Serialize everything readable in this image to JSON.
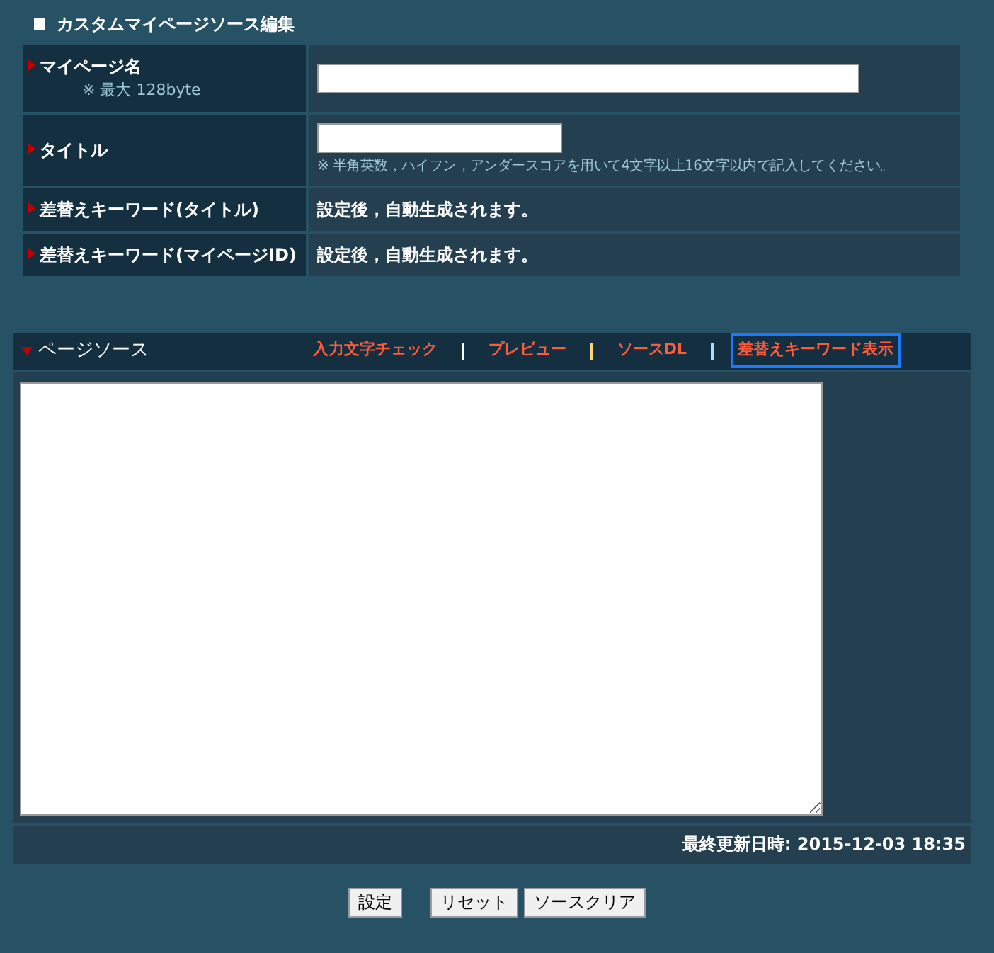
{
  "title": "カスタムマイページソース編集",
  "rows": [
    {
      "label": "マイページ名",
      "note": "※ 最大 128byte",
      "kind": "long-input"
    },
    {
      "label": "タイトル",
      "kind": "short-input",
      "hint": "※ 半角英数，ハイフン，アンダースコアを用いて4文字以上16文字以内で記入してください。"
    },
    {
      "label": "差替えキーワード(タイトル)",
      "kind": "text",
      "value": "設定後，自動生成されます。"
    },
    {
      "label": "差替えキーワード(マイページID)",
      "kind": "text",
      "value": "設定後，自動生成されます。"
    }
  ],
  "source": {
    "title": "ページソース",
    "links": [
      {
        "label": "入力文字チェック",
        "selected": false
      },
      {
        "label": "プレビュー",
        "selected": false
      },
      {
        "label": "ソースDL",
        "selected": false
      },
      {
        "label": "差替えキーワード表示",
        "selected": true
      }
    ],
    "updated": "最終更新日時: 2015-12-03 18:35"
  },
  "buttons": [
    "設定",
    "リセット",
    "ソースクリア"
  ]
}
